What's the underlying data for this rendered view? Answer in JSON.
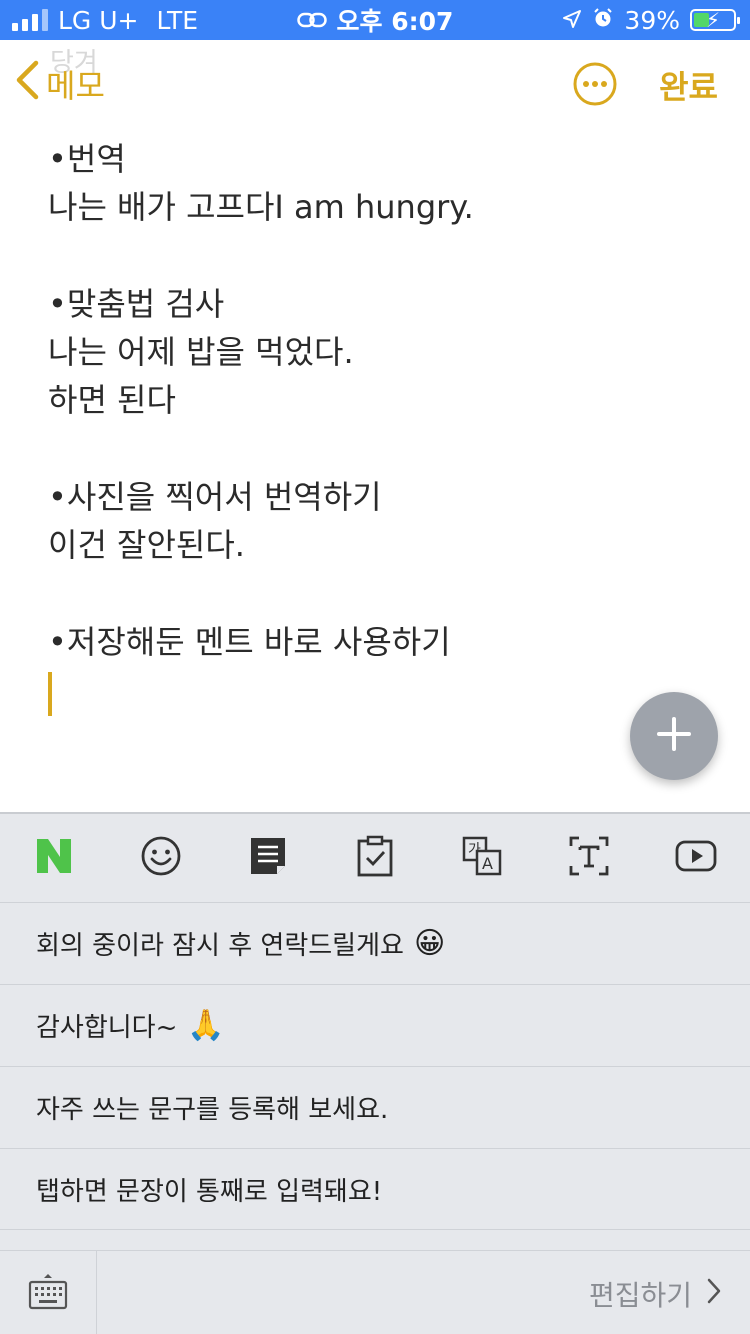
{
  "status_bar": {
    "carrier": "LG U+",
    "network": "LTE",
    "time": "오후 6:07",
    "battery": "39%",
    "battery_level": 0.39
  },
  "nav": {
    "faded_title": "당겨",
    "back_label": "메모",
    "done_label": "완료"
  },
  "note": {
    "lines": [
      "•번역",
      "나는 배가 고프다I am hungry.",
      "",
      "•맞춤법 검사",
      "나는 어제 밥을 먹었다.",
      "하면 된다",
      "",
      "•사진을 찍어서 번역하기",
      "이건 잘안된다.",
      "",
      "•저장해둔 멘트 바로 사용하기"
    ]
  },
  "toolbar": {
    "icons": [
      "naver-n-icon",
      "emoji-icon",
      "note-icon",
      "clipboard-icon",
      "translate-icon",
      "text-recognition-icon",
      "video-icon"
    ]
  },
  "phrases": [
    {
      "text": "회의 중이라 잠시 후 연락드릴게요",
      "emoji": "😀"
    },
    {
      "text": "감사합니다~",
      "emoji": "🙏"
    },
    {
      "text": "자주 쓰는 문구를 등록해 보세요.",
      "emoji": ""
    },
    {
      "text": "탭하면 문장이 통째로 입력돼요!",
      "emoji": ""
    }
  ],
  "bottom": {
    "edit_label": "편집하기"
  },
  "colors": {
    "accent": "#d9a81e",
    "status_bar": "#3a82f7",
    "naver_green": "#4fc34a",
    "panel": "#e6e8ec"
  }
}
